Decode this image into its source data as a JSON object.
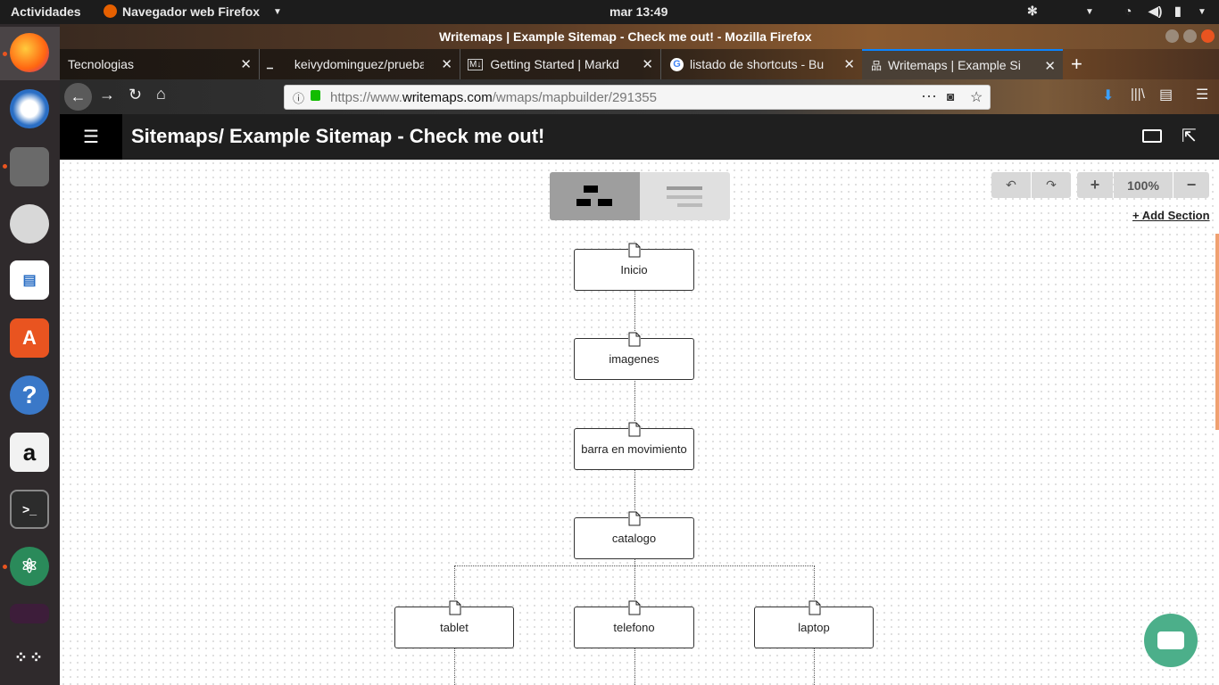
{
  "os": {
    "activities": "Actividades",
    "app_menu": "Navegador web Firefox",
    "clock": "mar 13:49"
  },
  "window": {
    "title": "Writemaps | Example Sitemap - Check me out! - Mozilla Firefox"
  },
  "tabs": [
    {
      "label": "Tecnologias"
    },
    {
      "label": "keivydominguez/prueba"
    },
    {
      "label": "Getting Started | Markdo"
    },
    {
      "label": "listado de shortcuts - Bu"
    },
    {
      "label": "Writemaps | Example Si"
    }
  ],
  "url": {
    "prefix": "https://www.",
    "domain": "writemaps.com",
    "path": "/wmaps/mapbuilder/291355"
  },
  "app": {
    "title": "Sitemaps/ Example Sitemap - Check me out!",
    "zoom": "100%",
    "add_section": "+ Add Section"
  },
  "nodes": {
    "inicio": "Inicio",
    "imagenes": "imagenes",
    "barra": "barra en movimiento",
    "catalogo": "catalogo",
    "tablet": "tablet",
    "telefono": "telefono",
    "laptop": "laptop"
  },
  "colors": {
    "firefox_accent": "#e95420",
    "chat_button": "#4caf8a",
    "tab_active": "#4a4036"
  }
}
